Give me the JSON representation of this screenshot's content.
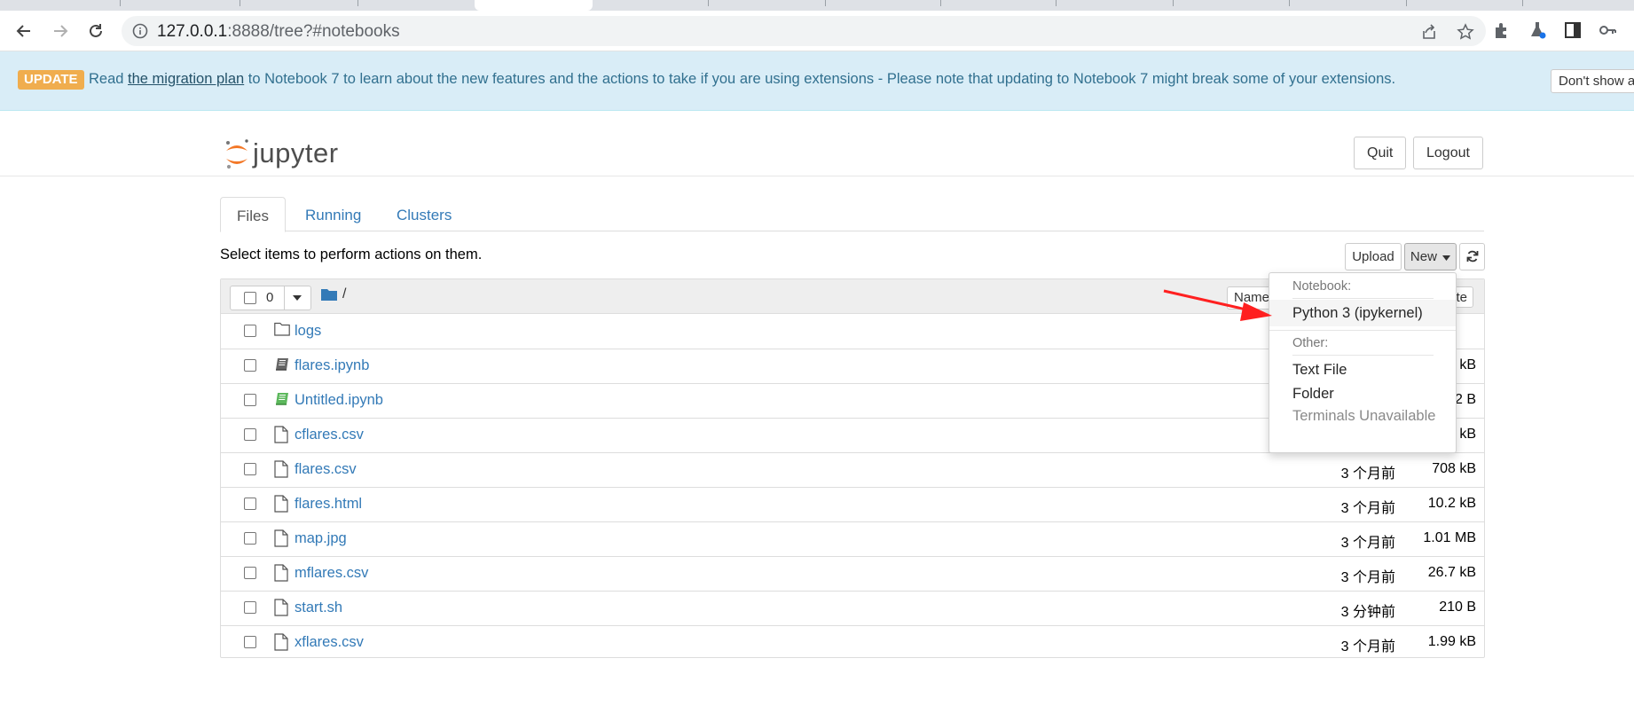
{
  "browser": {
    "url_host": "127.0.0.1",
    "url_rest": ":8888/tree?#notebooks"
  },
  "banner": {
    "badge": "UPDATE",
    "text_before": "Read ",
    "link": "the migration plan",
    "text_after": " to Notebook 7 to learn about the new features and the actions to take if you are using extensions - Please note that updating to Notebook 7 might break some of your extensions.",
    "dismiss": "Don't show a"
  },
  "header": {
    "logo_text": "jupyter",
    "quit": "Quit",
    "logout": "Logout"
  },
  "tabs": [
    "Files",
    "Running",
    "Clusters"
  ],
  "toolbar": {
    "select_text": "Select items to perform actions on them.",
    "upload": "Upload",
    "new": "New",
    "selected_count": "0"
  },
  "list_header": {
    "breadcrumb": "/",
    "name_sort": "Name",
    "modified_sort": "te"
  },
  "files": [
    {
      "name": "logs",
      "type": "folder",
      "modified": "",
      "size": ""
    },
    {
      "name": "flares.ipynb",
      "type": "notebook",
      "modified": "",
      "size": "kB"
    },
    {
      "name": "Untitled.ipynb",
      "type": "notebook-running",
      "modified": "",
      "size": "2 B"
    },
    {
      "name": "cflares.csv",
      "type": "file",
      "modified": "",
      "size": "kB"
    },
    {
      "name": "flares.csv",
      "type": "file",
      "modified": "3 个月前",
      "size": "708 kB"
    },
    {
      "name": "flares.html",
      "type": "file",
      "modified": "3 个月前",
      "size": "10.2 kB"
    },
    {
      "name": "map.jpg",
      "type": "file",
      "modified": "3 个月前",
      "size": "1.01 MB"
    },
    {
      "name": "mflares.csv",
      "type": "file",
      "modified": "3 个月前",
      "size": "26.7 kB"
    },
    {
      "name": "start.sh",
      "type": "file",
      "modified": "3 分钟前",
      "size": "210 B"
    },
    {
      "name": "xflares.csv",
      "type": "file",
      "modified": "3 个月前",
      "size": "1.99 kB"
    }
  ],
  "dropdown": {
    "notebook_header": "Notebook:",
    "python3": "Python 3 (ipykernel)",
    "other_header": "Other:",
    "text_file": "Text File",
    "folder": "Folder",
    "terminals": "Terminals Unavailable"
  },
  "colors": {
    "link": "#337ab7",
    "banner_bg": "#d9edf7",
    "badge": "#f0ad4e",
    "jupyter_orange": "#f37726",
    "annotation_arrow": "#ff2020"
  }
}
